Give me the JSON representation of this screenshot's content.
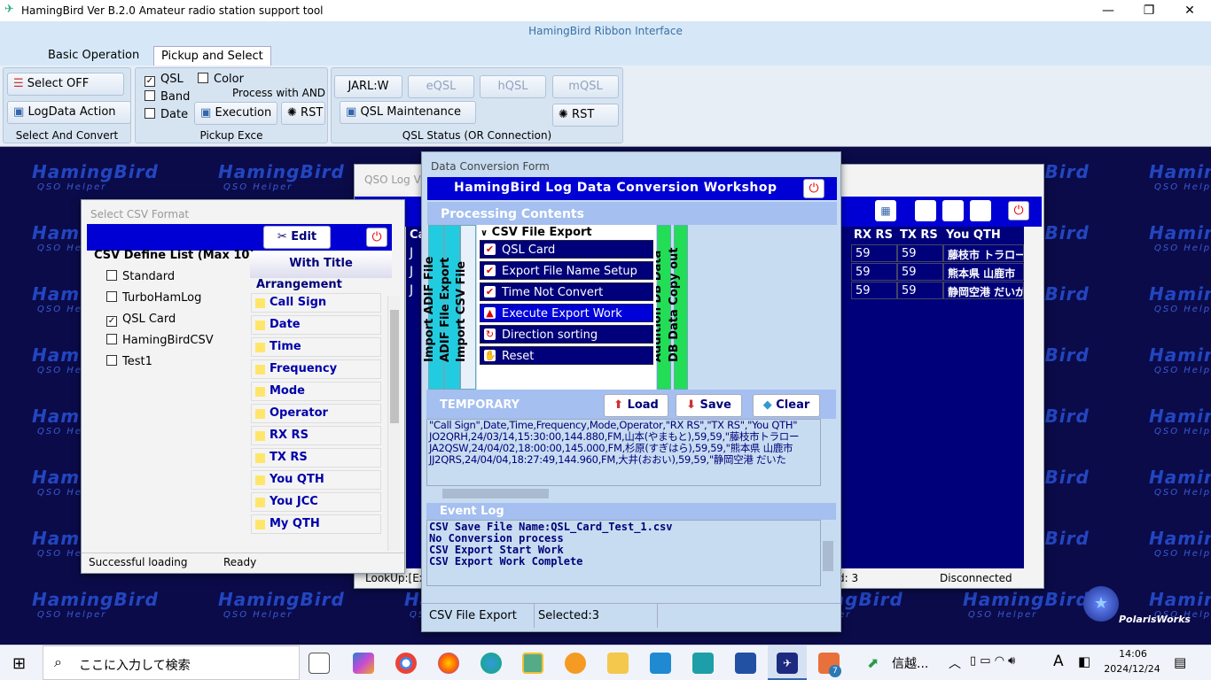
{
  "app": {
    "title": "HamingBird Ver B.2.0   Amateur radio station support tool",
    "ribbon_title": "HamingBird Ribbon Interface"
  },
  "tabs": [
    "Basic Operation",
    "Pickup and Select"
  ],
  "ribbon": {
    "select_and_convert": {
      "label": "Select And Convert",
      "select_off": "Select OFF",
      "logdata_action": "LogData Action"
    },
    "pickup_exce": {
      "label": "Pickup Exce",
      "qsl": "QSL",
      "color": "Color",
      "band": "Band",
      "process_with_and": "Process with AND",
      "date": "Date",
      "execution": "Execution",
      "rst": "RST",
      "qsl_checked": true
    },
    "qsl_status": {
      "label": "QSL Status (OR Connection)",
      "jarl": "JARL:W",
      "eqsl": "eQSL",
      "hqsl": "hQSL",
      "mqsl": "mQSL",
      "maintenance": "QSL Maintenance",
      "rst": "RST"
    }
  },
  "watermark": {
    "brand": "HamingBird",
    "sub": "QSO Helper"
  },
  "csv_form": {
    "title": "Select CSV Format",
    "edit": "Edit",
    "define_list_title": "CSV Define List (Max 10)",
    "defines": [
      {
        "label": "Standard",
        "checked": false
      },
      {
        "label": "TurboHamLog",
        "checked": false
      },
      {
        "label": "QSL Card",
        "checked": true
      },
      {
        "label": "HamingBirdCSV",
        "checked": false
      },
      {
        "label": "Test1",
        "checked": false
      }
    ],
    "with_title": "With Title",
    "arrangement": "Arrangement",
    "fields": [
      "Call Sign",
      "Date",
      "Time",
      "Frequency",
      "Mode",
      "Operator",
      "RX RS",
      "TX RS",
      "You QTH",
      "You JCC",
      "My QTH"
    ],
    "status": "Successful loading",
    "ready": "Ready"
  },
  "qso_view": {
    "title": "QSO Log Vi",
    "headers": [
      "Ca",
      "RX RS",
      "TX RS",
      "You QTH"
    ],
    "rows": [
      {
        "c": "J",
        "rx": "59",
        "tx": "59",
        "qth": "藤枝市 トラロー"
      },
      {
        "c": "J",
        "rx": "59",
        "tx": "59",
        "qth": "熊本県 山鹿市"
      },
      {
        "c": "J",
        "rx": "59",
        "tx": "59",
        "qth": "静岡空港 だいが"
      }
    ],
    "lookup": "LookUp:[Ext",
    "count": "d: 3",
    "conn": "Disconnected"
  },
  "conv": {
    "title": "Data Conversion Form",
    "banner": "HamingBird Log Data Conversion Workshop",
    "processing": "Processing Contents",
    "vtabs": [
      "Import ADIF File",
      "ADIF File Export",
      "Import CSV File",
      "Addition DB Data",
      "DB Data Copy out"
    ],
    "section": "CSV File Export",
    "procs": [
      {
        "label": "QSL Card",
        "icon": "check"
      },
      {
        "label": "Export File Name Setup",
        "icon": "check"
      },
      {
        "label": "Time Not Convert",
        "icon": "check"
      },
      {
        "label": "Execute Export Work",
        "icon": "rocket"
      },
      {
        "label": "Direction sorting",
        "icon": "sort"
      },
      {
        "label": "Reset",
        "icon": "reset"
      }
    ],
    "temporary": "TEMPORARY",
    "load": "Load",
    "save": "Save",
    "clear": "Clear",
    "csv_lines": [
      "\"Call Sign\",Date,Time,Frequency,Mode,Operator,\"RX RS\",\"TX RS\",\"You QTH\"",
      "JO2QRH,24/03/14,15:30:00,144.880,FM,山本(やまもと),59,59,\"藤枝市トラロー",
      "JA2QSW,24/04/02,18:00:00,145.000,FM,杉原(すぎはら),59,59,\"熊本県 山鹿市",
      "JJ2QRS,24/04/04,18:27:49,144.960,FM,大井(おおい),59,59,\"静岡空港 だいた"
    ],
    "event_log": "Event Log",
    "events": [
      "CSV Save File Name:QSL_Card_Test_1.csv",
      "No Conversion process",
      "CSV Export Start Work",
      "CSV Export Work Complete"
    ],
    "status": "CSV File Export",
    "selected": "Selected:3"
  },
  "polaris": "PolarisWorks",
  "taskbar": {
    "search": "ここに入力して検索",
    "app_text": "信越...",
    "ime": "A",
    "time": "14:06",
    "date": "2024/12/24",
    "badge": "7"
  }
}
